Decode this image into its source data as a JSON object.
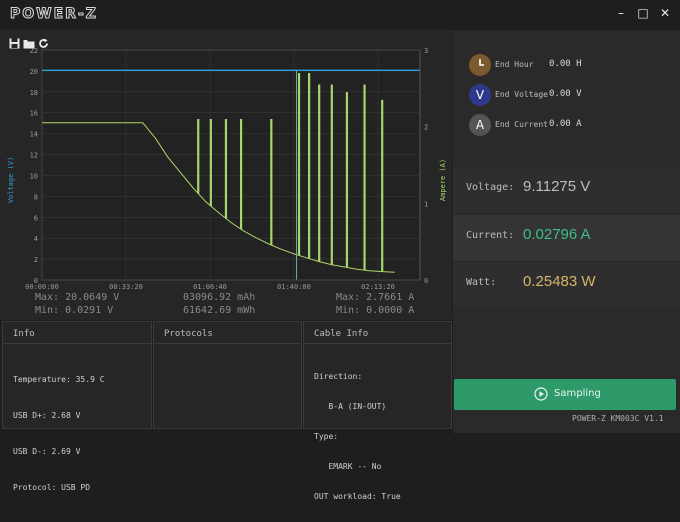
{
  "app": {
    "title": "POWER-Z",
    "version": "POWER-Z KM003C V1.1"
  },
  "window_controls": {
    "minimize": "–",
    "maximize": "□",
    "close": "✕"
  },
  "toolbar": {
    "icons": [
      "save-icon",
      "folder-icon",
      "refresh-icon"
    ]
  },
  "chart_data": {
    "type": "line",
    "x_ticks": [
      "00:00:00",
      "00:33:20",
      "01:06:40",
      "01:40:00",
      "02:13:20"
    ],
    "y_left_label": "Voltage (V)",
    "y_left_ticks": [
      "0",
      "2",
      "4",
      "6",
      "8",
      "10",
      "12",
      "14",
      "16",
      "18",
      "20",
      "22"
    ],
    "y_left_range": [
      0,
      22
    ],
    "y_right_label": "Ampere (A)",
    "y_right_ticks": [
      "0",
      "1",
      "2",
      "3"
    ],
    "y_right_range": [
      0,
      3
    ],
    "x_range_s": [
      0,
      9000
    ],
    "series": [
      {
        "name": "Voltage",
        "color": "#2f9fd8",
        "axis": "left",
        "x": [
          0,
          9000
        ],
        "y": [
          20.06,
          20.06
        ]
      },
      {
        "name": "Current",
        "color": "#a9d66b",
        "axis": "right",
        "x": [
          0,
          2400,
          2700,
          3000,
          3300,
          3600,
          3900,
          4200,
          4500,
          4800,
          5100,
          5400,
          5700,
          6000,
          6300,
          6600,
          6900,
          7200,
          7500,
          7800,
          8100,
          8400
        ],
        "y": [
          2.05,
          2.05,
          1.85,
          1.6,
          1.4,
          1.2,
          1.02,
          0.88,
          0.75,
          0.64,
          0.55,
          0.47,
          0.4,
          0.34,
          0.29,
          0.24,
          0.2,
          0.17,
          0.14,
          0.12,
          0.11,
          0.1
        ]
      }
    ],
    "current_spikes": [
      {
        "x": 3720,
        "top": 2.1
      },
      {
        "x": 4020,
        "top": 2.1
      },
      {
        "x": 4380,
        "top": 2.1
      },
      {
        "x": 4740,
        "top": 2.1
      },
      {
        "x": 5460,
        "top": 2.1
      },
      {
        "x": 6120,
        "top": 2.7
      },
      {
        "x": 6360,
        "top": 2.7
      },
      {
        "x": 6600,
        "top": 2.55
      },
      {
        "x": 6900,
        "top": 2.55
      },
      {
        "x": 7260,
        "top": 2.45
      },
      {
        "x": 7680,
        "top": 2.55
      },
      {
        "x": 8100,
        "top": 2.35
      }
    ]
  },
  "stats": {
    "max_v": "Max: 20.0649 V",
    "min_v": "Min: 0.0291 V",
    "mah": "03096.92 mAh",
    "mwh": "61642.69 mWh",
    "max_a": "Max: 2.7661 A",
    "min_a": "Min: 0.0000 A"
  },
  "panels": {
    "info": {
      "title": "Info",
      "lines": [
        "Temperature: 35.9 C",
        "USB D+: 2.68 V",
        "USB D-: 2.69 V",
        "Protocol: USB PD"
      ]
    },
    "protocols": {
      "title": "Protocols"
    },
    "cable": {
      "title": "Cable Info",
      "lines": [
        "Direction:",
        "   B-A (IN-OUT)",
        "Type:",
        "   EMARK -- No",
        "OUT workload: True"
      ]
    }
  },
  "end": [
    {
      "icon_letter": "",
      "icon": "clock-icon",
      "label": "End Hour",
      "value": "0.00 H",
      "color": "#7a5a2e"
    },
    {
      "icon_letter": "V",
      "icon": "volt-icon",
      "label": "End Voltage",
      "value": "0.00 V",
      "color": "#2d3a8a"
    },
    {
      "icon_letter": "A",
      "icon": "ampere-icon",
      "label": "End Current",
      "value": "0.00 A",
      "color": "#555555"
    }
  ],
  "measurements": {
    "voltage": {
      "label": "Voltage:",
      "value": "9.11275 V",
      "color": "#bdbdbd"
    },
    "current": {
      "label": "Current:",
      "value": "0.02796 A",
      "color": "#3fbf8a"
    },
    "watt": {
      "label": "Watt:",
      "value": "0.25483 W",
      "color": "#d9b46a"
    }
  },
  "sampling": {
    "label": "Sampling"
  }
}
